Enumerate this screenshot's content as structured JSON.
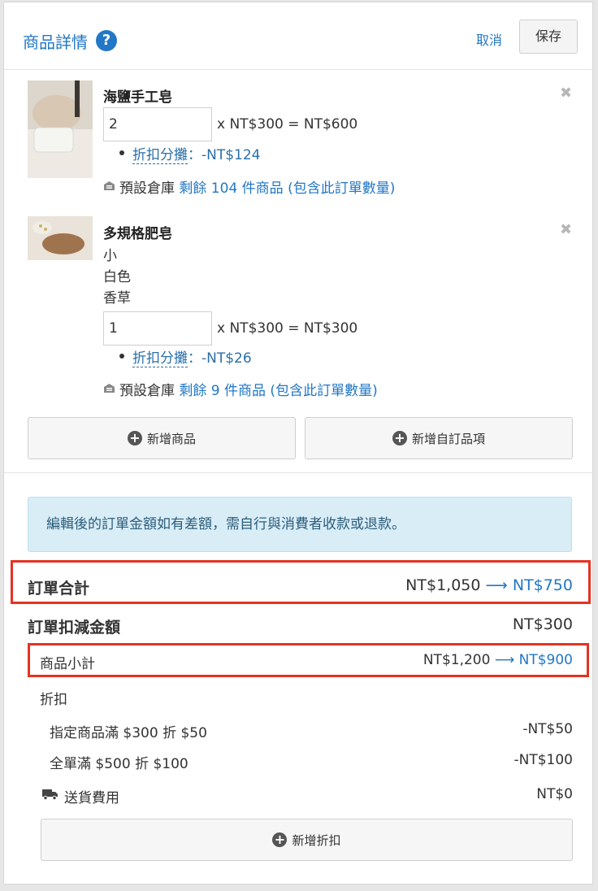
{
  "header": {
    "title": "商品詳情",
    "help_icon": "question-circle-icon",
    "cancel": "取消",
    "save": "保存"
  },
  "products": [
    {
      "name": "海鹽手工皂",
      "quantity": "2",
      "price_line": "x NT$300 = NT$600",
      "discount_label": "折扣分攤",
      "discount_value": "：-NT$124",
      "warehouse_label": "預設倉庫",
      "stock_text": "剩餘 104 件商品 (包含此訂單數量)",
      "variants": []
    },
    {
      "name": "多規格肥皂",
      "variants": [
        "小",
        "白色",
        "香草"
      ],
      "quantity": "1",
      "price_line": "x NT$300 = NT$300",
      "discount_label": "折扣分攤",
      "discount_value": "：-NT$26",
      "warehouse_label": "預設倉庫",
      "stock_text": "剩餘 9 件商品 (包含此訂單數量)"
    }
  ],
  "buttons": {
    "add_product": "新增商品",
    "add_custom": "新增自訂品項",
    "add_discount": "新增折扣"
  },
  "notice": "編輯後的訂單金額如有差額，需自行與消費者收款或退款。",
  "summary": {
    "order_total_label": "訂單合計",
    "order_total_old": "NT$1,050",
    "order_total_new": "NT$750",
    "deduction_label": "訂單扣減金額",
    "deduction_value": "NT$300",
    "subtotal_label": "商品小計",
    "subtotal_old": "NT$1,200",
    "subtotal_new": "NT$900",
    "discount_label": "折扣",
    "discount_items": [
      {
        "label": "指定商品滿 $300 折 $50",
        "value": "-NT$50"
      },
      {
        "label": "全單滿 $500 折 $100",
        "value": "-NT$100"
      }
    ],
    "shipping_label": "送貨費用",
    "shipping_value": "NT$0"
  },
  "colors": {
    "accent": "#2277c6",
    "highlight_border": "#e53222",
    "notice_bg": "#d9edf7"
  }
}
